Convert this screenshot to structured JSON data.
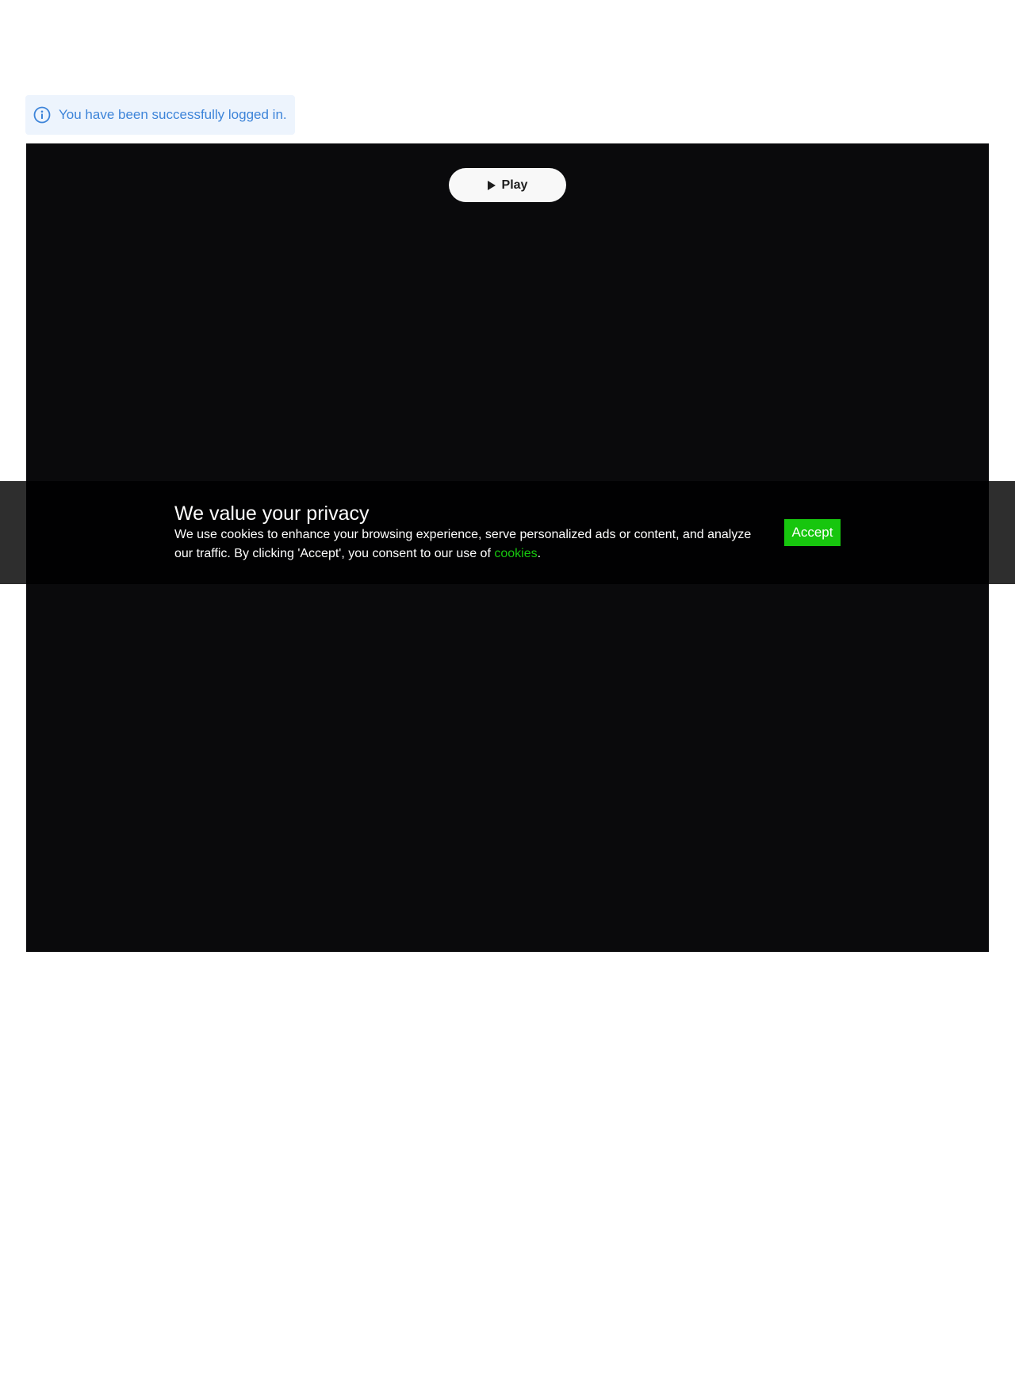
{
  "alert": {
    "icon": "info-circle-icon",
    "message": "You have been successfully logged in.",
    "color": "#3d84d9",
    "background": "#edf4fd"
  },
  "player": {
    "background": "#0a0a0c",
    "play_button": {
      "icon": "play-icon",
      "label": "Play"
    }
  },
  "cookie_banner": {
    "title": "We value your privacy",
    "text_before_link": "We use cookies to enhance your browsing experience, serve personalized ads or content, and analyze our traffic. By clicking 'Accept', you consent to our use of ",
    "link_label": "cookies",
    "text_after_link": ".",
    "accept_label": "Accept",
    "accent_color": "#17c60e"
  }
}
